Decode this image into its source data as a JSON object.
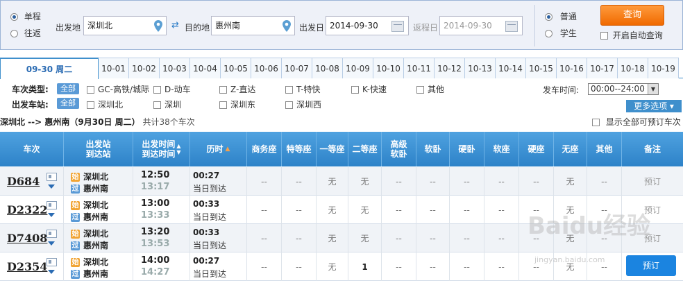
{
  "search": {
    "trip_types": [
      "单程",
      "往返"
    ],
    "from_label": "出发地",
    "from_value": "深圳北",
    "to_label": "目的地",
    "to_value": "惠州南",
    "depart_label": "出发日",
    "depart_value": "2014-09-30",
    "return_label": "返程日",
    "return_value": "2014-09-30",
    "passenger_types": [
      "普通",
      "学生"
    ],
    "query_label": "查询",
    "auto_query_label": "开启自动查询"
  },
  "dates": [
    "09-30 周二",
    "10-01",
    "10-02",
    "10-03",
    "10-04",
    "10-05",
    "10-06",
    "10-07",
    "10-08",
    "10-09",
    "10-10",
    "10-11",
    "10-12",
    "10-13",
    "10-14",
    "10-15",
    "10-16",
    "10-17",
    "10-18",
    "10-19"
  ],
  "filters": {
    "type_label": "车次类型:",
    "station_label": "出发车站:",
    "all_label": "全部",
    "train_types": [
      "GC-高铁/城际",
      "D-动车",
      "Z-直达",
      "T-特快",
      "K-快速",
      "其他"
    ],
    "stations": [
      "深圳北",
      "深圳",
      "深圳东",
      "深圳西"
    ],
    "time_label": "发车时间:",
    "time_value": "00:00--24:00",
    "more_label": "更多选项"
  },
  "route": {
    "summary": "深圳北 --> 惠州南（9月30日  周二）",
    "count": "共计38个车次",
    "show_all_label": "显示全部可预订车次"
  },
  "table": {
    "headers": {
      "train": "车次",
      "station_from": "出发站",
      "station_to": "到达站",
      "time_from": "出发时间",
      "time_to": "到达时间",
      "duration": "历时",
      "business": "商务座",
      "special": "特等座",
      "first": "一等座",
      "second": "二等座",
      "sleeper_top_1": "高级",
      "sleeper_top_2": "软卧",
      "soft_sleeper": "软卧",
      "hard_sleeper": "硬卧",
      "soft_seat": "软座",
      "hard_seat": "硬座",
      "no_seat": "无座",
      "other": "其他",
      "remark": "备注"
    },
    "badge_start": "始",
    "badge_pass": "过",
    "arrive_text": "当日到达",
    "rows": [
      {
        "no": "D684",
        "from": "深圳北",
        "to": "惠州南",
        "dep": "12:50",
        "arr": "13:17",
        "dur": "00:27",
        "seats": [
          "--",
          "--",
          "无",
          "无",
          "--",
          "--",
          "--",
          "--",
          "--",
          "无",
          "--"
        ],
        "remark": "预订"
      },
      {
        "no": "D2322",
        "from": "深圳北",
        "to": "惠州南",
        "dep": "13:00",
        "arr": "13:33",
        "dur": "00:33",
        "seats": [
          "--",
          "--",
          "无",
          "无",
          "--",
          "--",
          "--",
          "--",
          "--",
          "无",
          "--"
        ],
        "remark": "预订"
      },
      {
        "no": "D7408",
        "from": "深圳北",
        "to": "惠州南",
        "dep": "13:20",
        "arr": "13:53",
        "dur": "00:33",
        "seats": [
          "--",
          "--",
          "无",
          "无",
          "--",
          "--",
          "--",
          "--",
          "--",
          "无",
          "--"
        ],
        "remark": "预订"
      },
      {
        "no": "D2354",
        "from": "深圳北",
        "to": "惠州南",
        "dep": "14:00",
        "arr": "14:27",
        "dur": "00:27",
        "seats": [
          "--",
          "--",
          "无",
          "1",
          "--",
          "--",
          "--",
          "--",
          "--",
          "无",
          "--"
        ],
        "remark": "预订"
      }
    ]
  },
  "watermark": {
    "main": "Baidu经验",
    "sub": "jingyan.baidu.com"
  }
}
